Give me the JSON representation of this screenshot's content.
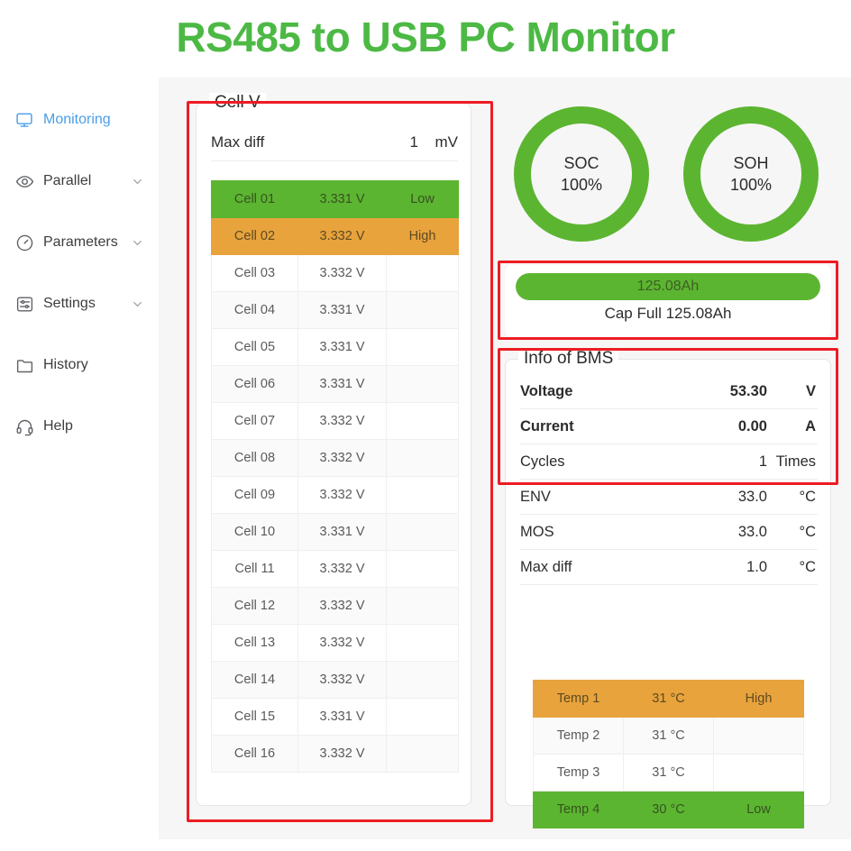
{
  "header": {
    "title": "RS485 to USB PC Monitor",
    "title_color": "#4cb944"
  },
  "sidebar": {
    "items": [
      {
        "label": "Monitoring",
        "icon": "monitor-icon",
        "active": true,
        "chevron": false
      },
      {
        "label": "Parallel",
        "icon": "eye-icon",
        "active": false,
        "chevron": true
      },
      {
        "label": "Parameters",
        "icon": "gauge-icon",
        "active": false,
        "chevron": true
      },
      {
        "label": "Settings",
        "icon": "sliders-icon",
        "active": false,
        "chevron": true
      },
      {
        "label": "History",
        "icon": "folder-icon",
        "active": false,
        "chevron": false
      },
      {
        "label": "Help",
        "icon": "headset-icon",
        "active": false,
        "chevron": false
      }
    ]
  },
  "cell_voltage": {
    "legend": "Cell V",
    "max_diff_label": "Max diff",
    "max_diff_value": "1",
    "max_diff_unit": "mV",
    "rows": [
      {
        "name": "Cell 01",
        "value": "3.331 V",
        "status": "Low",
        "state": "low"
      },
      {
        "name": "Cell 02",
        "value": "3.332 V",
        "status": "High",
        "state": "high"
      },
      {
        "name": "Cell 03",
        "value": "3.332 V",
        "status": "",
        "state": ""
      },
      {
        "name": "Cell 04",
        "value": "3.331 V",
        "status": "",
        "state": ""
      },
      {
        "name": "Cell 05",
        "value": "3.331 V",
        "status": "",
        "state": ""
      },
      {
        "name": "Cell 06",
        "value": "3.331 V",
        "status": "",
        "state": ""
      },
      {
        "name": "Cell 07",
        "value": "3.332 V",
        "status": "",
        "state": ""
      },
      {
        "name": "Cell 08",
        "value": "3.332 V",
        "status": "",
        "state": ""
      },
      {
        "name": "Cell 09",
        "value": "3.332 V",
        "status": "",
        "state": ""
      },
      {
        "name": "Cell 10",
        "value": "3.331 V",
        "status": "",
        "state": ""
      },
      {
        "name": "Cell 11",
        "value": "3.332 V",
        "status": "",
        "state": ""
      },
      {
        "name": "Cell 12",
        "value": "3.332 V",
        "status": "",
        "state": ""
      },
      {
        "name": "Cell 13",
        "value": "3.332 V",
        "status": "",
        "state": ""
      },
      {
        "name": "Cell 14",
        "value": "3.332 V",
        "status": "",
        "state": ""
      },
      {
        "name": "Cell 15",
        "value": "3.331 V",
        "status": "",
        "state": ""
      },
      {
        "name": "Cell 16",
        "value": "3.332 V",
        "status": "",
        "state": ""
      }
    ]
  },
  "gauges": [
    {
      "name": "SOC",
      "value": "100%",
      "percent": 100,
      "color": "#5cb531"
    },
    {
      "name": "SOH",
      "value": "100%",
      "percent": 100,
      "color": "#5cb531"
    }
  ],
  "capacity": {
    "bar_text": "125.08Ah",
    "percent": 100,
    "sub_text": "Cap Full 125.08Ah",
    "color": "#5cb531"
  },
  "bms_info": {
    "legend": "Info of BMS",
    "rows": [
      {
        "key": "Voltage",
        "value": "53.30",
        "unit": "V",
        "bold": true
      },
      {
        "key": "Current",
        "value": "0.00",
        "unit": "A",
        "bold": true
      },
      {
        "key": "Cycles",
        "value": "1",
        "unit": "Times",
        "bold": false
      },
      {
        "key": "ENV",
        "value": "33.0",
        "unit": "°C",
        "bold": false
      },
      {
        "key": "MOS",
        "value": "33.0",
        "unit": "°C",
        "bold": false
      },
      {
        "key": "Max diff",
        "value": "1.0",
        "unit": "°C",
        "bold": false
      }
    ],
    "temp_rows": [
      {
        "name": "Temp 1",
        "value": "31 °C",
        "status": "High",
        "state": "high"
      },
      {
        "name": "Temp 2",
        "value": "31 °C",
        "status": "",
        "state": ""
      },
      {
        "name": "Temp 3",
        "value": "31 °C",
        "status": "",
        "state": ""
      },
      {
        "name": "Temp 4",
        "value": "30 °C",
        "status": "Low",
        "state": "low"
      }
    ]
  },
  "annotations": {
    "highlight_color": "#ed1c24",
    "boxes": [
      "cell-v-panel",
      "capacity-panel",
      "bms-info-top"
    ]
  }
}
